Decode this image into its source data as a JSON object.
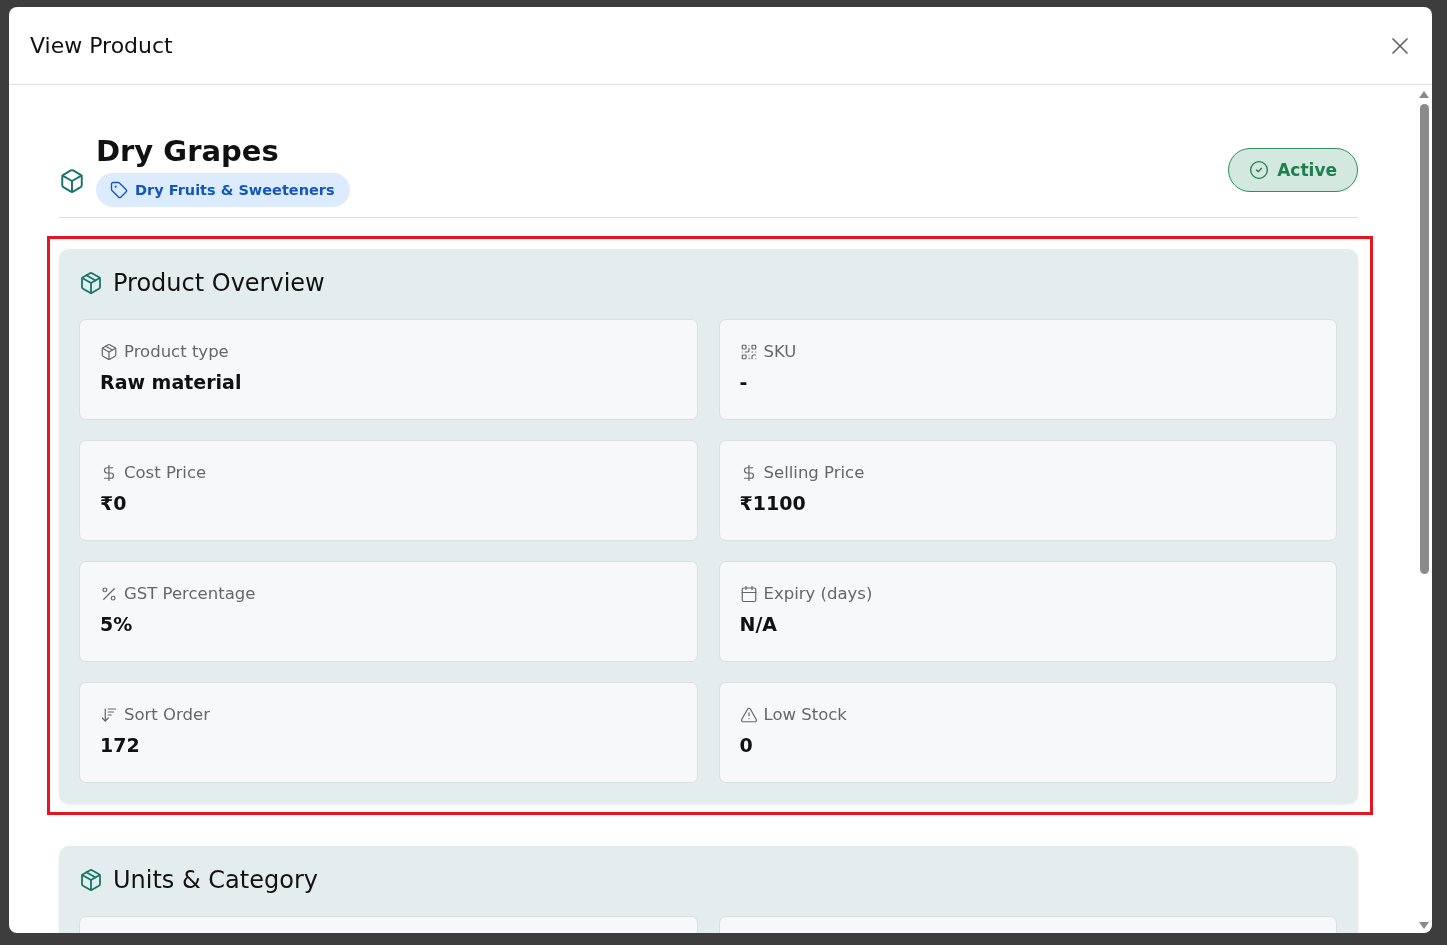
{
  "dialog": {
    "title": "View Product"
  },
  "product": {
    "name": "Dry Grapes",
    "category": "Dry Fruits & Sweeteners",
    "status": {
      "label": "Active",
      "active": true
    }
  },
  "sections": [
    {
      "title": "Product Overview",
      "highlighted": true,
      "fields": [
        {
          "kind": "type",
          "label": "Product type",
          "value": "Raw material"
        },
        {
          "kind": "sku",
          "label": "SKU",
          "value": "-"
        },
        {
          "kind": "money",
          "label": "Cost Price",
          "value": "₹0"
        },
        {
          "kind": "money",
          "label": "Selling Price",
          "value": "₹1100"
        },
        {
          "kind": "percent",
          "label": "GST Percentage",
          "value": "5%"
        },
        {
          "kind": "date",
          "label": "Expiry (days)",
          "value": "N/A"
        },
        {
          "kind": "order",
          "label": "Sort Order",
          "value": "172"
        },
        {
          "kind": "stock",
          "label": "Low Stock",
          "value": "0"
        }
      ]
    },
    {
      "title": "Units & Category",
      "highlighted": false
    }
  ]
}
